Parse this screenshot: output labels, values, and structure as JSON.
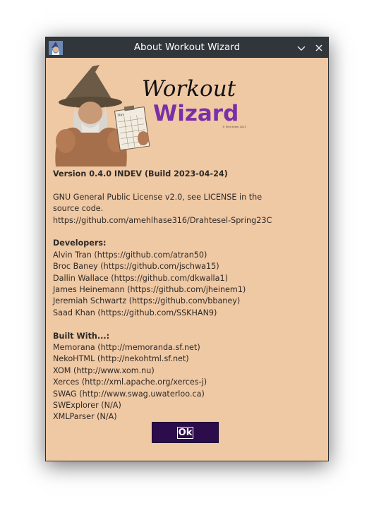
{
  "window": {
    "title": "About Workout Wizard"
  },
  "logo": {
    "line1": "Workout",
    "line2": "Wizard",
    "note": "© Ered team 2023",
    "clipboard_label": "Day"
  },
  "about": {
    "version": "Version 0.4.0 INDEV (Build 2023-04-24)",
    "license_lines": [
      "GNU General Public License v2.0, see LICENSE in the",
      "source code.",
      "https://github.com/amehlhase316/Drahtesel-Spring23C"
    ],
    "developers_heading": "Developers:",
    "developers": [
      "Alvin Tran (https://github.com/atran50)",
      "Broc Baney (https://github.com/jschwa15)",
      "Dallin Wallace (https://github.com/dkwalla1)",
      "James Heinemann (https://github.com/jheinem1)",
      "Jeremiah Schwartz (https://github.com/bbaney)",
      "Saad Khan (https://github.com/SSKHAN9)"
    ],
    "built_with_heading": "Built With...:",
    "built_with": [
      "Memorana (http://memoranda.sf.net)",
      "NekoHTML (http://nekohtml.sf.net)",
      "XOM (http://www.xom.nu)",
      "Xerces (http://xml.apache.org/xerces-j)",
      "SWAG (http://www.swag.uwaterloo.ca)",
      "SWExplorer (N/A)",
      "XMLParser (N/A)"
    ]
  },
  "ok_button": {
    "label": "Ok"
  },
  "colors": {
    "background": "#efc8a4",
    "titlebar": "#31363b",
    "wizard_purple": "#7a2fa6",
    "ok_button": "#2c0c4a"
  }
}
